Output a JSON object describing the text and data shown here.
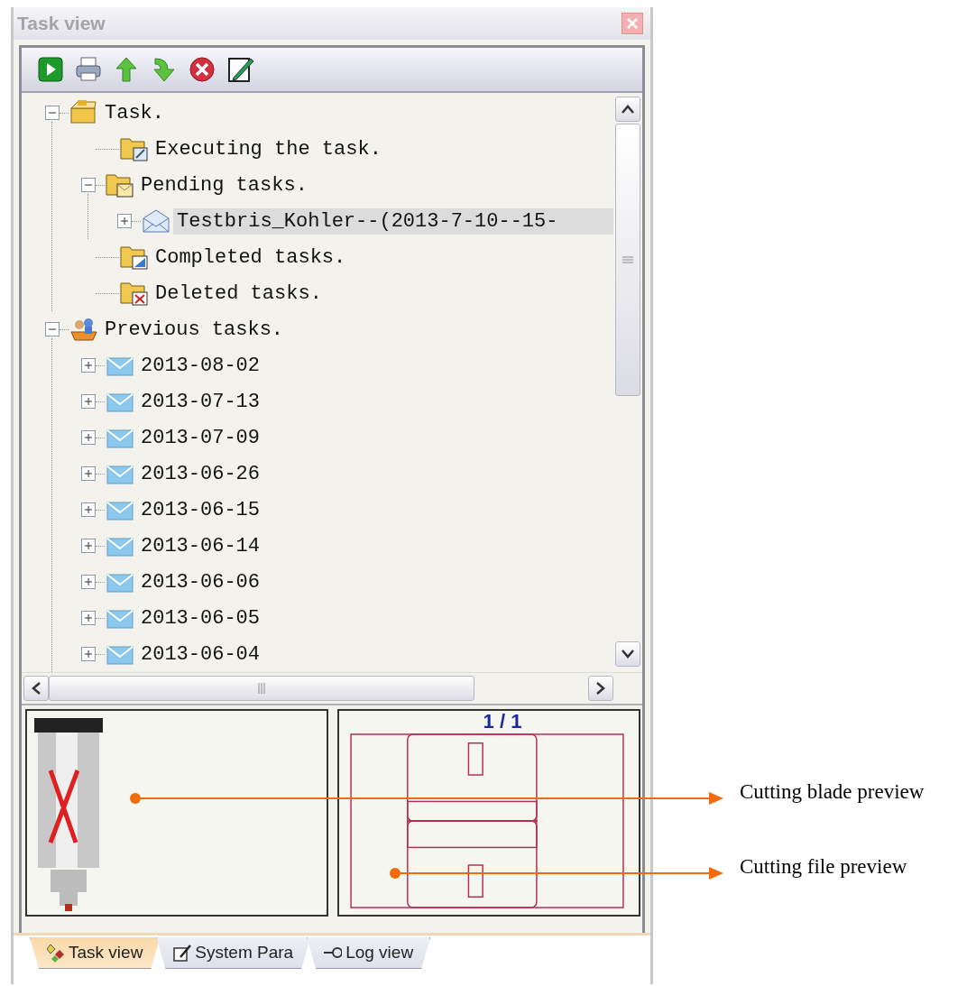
{
  "window": {
    "title": "Task view"
  },
  "toolbar": [
    {
      "kind": "run"
    },
    {
      "kind": "print"
    },
    {
      "kind": "up"
    },
    {
      "kind": "down"
    },
    {
      "kind": "stop"
    },
    {
      "kind": "edit"
    }
  ],
  "tree": [
    {
      "label": "Task.",
      "kind": "box",
      "expanded": true,
      "selected": false,
      "children": [
        {
          "label": "Executing the task.",
          "kind": "folder-pen",
          "selected": false
        },
        {
          "label": "Pending tasks.",
          "kind": "folder-mail",
          "expanded": true,
          "selected": false,
          "children": [
            {
              "label": "Testbris_Kohler--(2013-7-10--15-",
              "kind": "mail-open",
              "expanded": false,
              "selected": true
            }
          ]
        },
        {
          "label": "Completed tasks.",
          "kind": "folder-blue",
          "selected": false
        },
        {
          "label": "Deleted tasks.",
          "kind": "folder-x",
          "selected": false
        }
      ]
    },
    {
      "label": "Previous tasks.",
      "kind": "people",
      "expanded": true,
      "selected": false,
      "children": [
        {
          "label": "2013-08-02",
          "kind": "mail",
          "expanded": false,
          "selected": false
        },
        {
          "label": "2013-07-13",
          "kind": "mail",
          "expanded": false,
          "selected": false
        },
        {
          "label": "2013-07-09",
          "kind": "mail",
          "expanded": false,
          "selected": false
        },
        {
          "label": "2013-06-26",
          "kind": "mail",
          "expanded": false,
          "selected": false
        },
        {
          "label": "2013-06-15",
          "kind": "mail",
          "expanded": false,
          "selected": false
        },
        {
          "label": "2013-06-14",
          "kind": "mail",
          "expanded": false,
          "selected": false
        },
        {
          "label": "2013-06-06",
          "kind": "mail",
          "expanded": false,
          "selected": false
        },
        {
          "label": "2013-06-05",
          "kind": "mail",
          "expanded": false,
          "selected": false
        },
        {
          "label": "2013-06-04",
          "kind": "mail",
          "expanded": false,
          "selected": false
        }
      ]
    }
  ],
  "file_preview": {
    "page_counter": "1 / 1"
  },
  "tabs": [
    {
      "label": "Task view",
      "kind": "task",
      "selected": true
    },
    {
      "label": "System Para",
      "kind": "para",
      "selected": false
    },
    {
      "label": "Log view",
      "kind": "log",
      "selected": false
    }
  ],
  "callouts": [
    {
      "label": "Cutting blade preview"
    },
    {
      "label": "Cutting file preview"
    }
  ]
}
